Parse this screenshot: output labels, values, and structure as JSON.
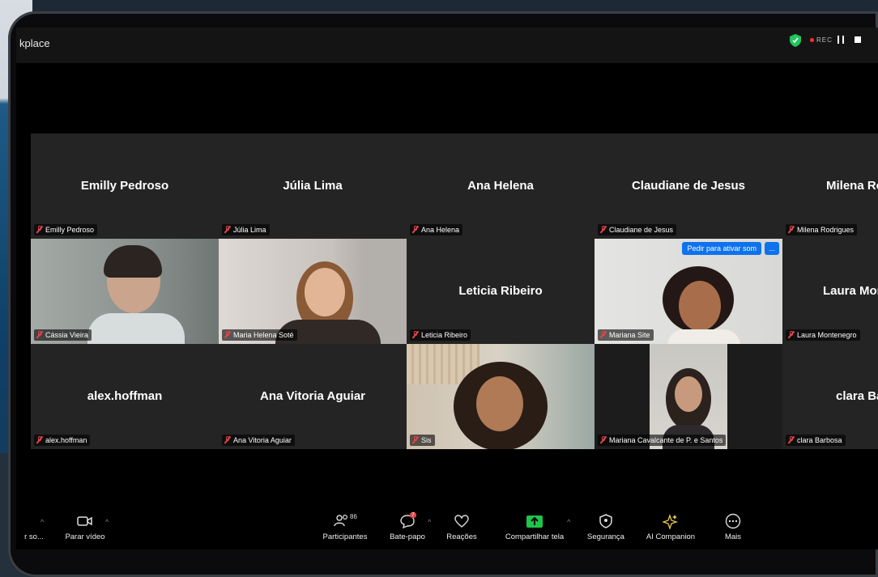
{
  "window": {
    "title": "kplace",
    "rec_label": "REC"
  },
  "tiles": [
    {
      "big": "Emilly Pedroso",
      "label": "Emilly Pedroso"
    },
    {
      "big": "Júlia Lima",
      "label": "Júlia Lima"
    },
    {
      "big": "Ana Helena",
      "label": "Ana Helena"
    },
    {
      "big": "Claudiane de Jesus",
      "label": "Claudiane de Jesus"
    },
    {
      "big": "Milena Ro",
      "label": "Milena Rodrigues"
    },
    {
      "label": "Cássia Vieira"
    },
    {
      "label": "Maria Helena Soté"
    },
    {
      "big": "Leticia Ribeiro",
      "label": "Leticia Ribeiro"
    },
    {
      "label": "Mariana Site"
    },
    {
      "big": "Laura Mon",
      "label": "Laura Montenegro"
    },
    {
      "big": "alex.hoffman",
      "label": "alex.hoffman"
    },
    {
      "big": "Ana Vitoria Aguiar",
      "label": "Ana Vitoria Aguiar"
    },
    {
      "label": "Sis"
    },
    {
      "label": "Mariana Cavalcante de P. e Santos"
    },
    {
      "big": "clara Ba",
      "label": "clara Barbosa"
    }
  ],
  "unmute_request": {
    "label": "Pedir para ativar som",
    "more": "..."
  },
  "toolbar": {
    "audio": "r so...",
    "video": "Parar vídeo",
    "participants": "Participantes",
    "participants_count": "86",
    "chat": "Bate-papo",
    "chat_badge": "7",
    "reactions": "Reações",
    "share": "Compartilhar tela",
    "security": "Segurança",
    "ai": "AI Companion",
    "more": "Mais"
  },
  "colors": {
    "accent": "#0e72ed",
    "share_green": "#1fc44a",
    "muted_red": "#e0454a",
    "secure_green": "#22c55e"
  }
}
